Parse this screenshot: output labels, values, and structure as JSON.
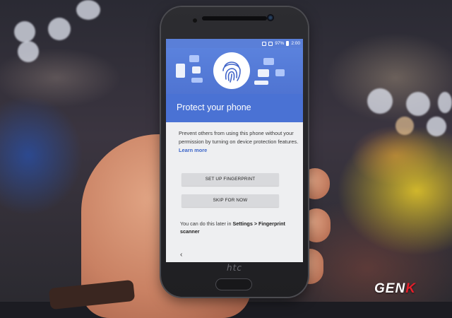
{
  "status_bar": {
    "battery": "97%",
    "time": "2:00"
  },
  "setup_screen": {
    "title": "Protect your phone",
    "description": "Prevent others from using this phone without your permission by turning on device protection features.",
    "learn_more_label": "Learn more",
    "setup_fingerprint_label": "SET UP FINGERPRINT",
    "skip_label": "SKIP FOR NOW",
    "later_prefix": "You can do this later in",
    "later_path": "Settings > Fingerprint scanner",
    "back_glyph": "‹"
  },
  "device": {
    "brand": "htc"
  },
  "watermark": {
    "prefix": "GEN",
    "suffix": "K"
  },
  "colors": {
    "header_blue": "#4a72d4",
    "link_blue": "#3d66c9",
    "button_gray": "#d8d9dc"
  }
}
